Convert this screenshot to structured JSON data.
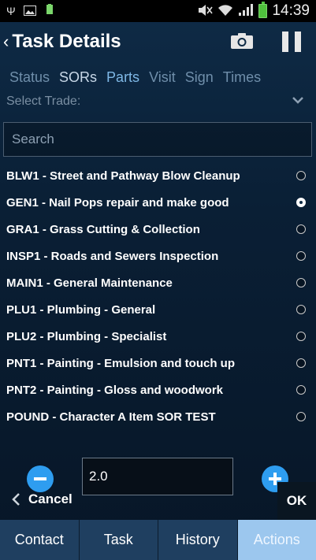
{
  "status_bar": {
    "time": "14:39",
    "icons": [
      "usb-icon",
      "image-icon",
      "battery-100-icon",
      "mute-icon",
      "wifi-icon",
      "signal-icon",
      "battery-icon"
    ],
    "small_battery_label": "100%"
  },
  "header": {
    "title": "Task Details",
    "back_caret": "‹"
  },
  "tabs": [
    {
      "label": "Status"
    },
    {
      "label": "SORs"
    },
    {
      "label": "Parts"
    },
    {
      "label": "Visit"
    },
    {
      "label": "Sign"
    },
    {
      "label": "Times"
    }
  ],
  "select_trade": {
    "label": "Select Trade:"
  },
  "search": {
    "placeholder": "Search",
    "value": ""
  },
  "items": [
    {
      "label": "BLW1 - Street and Pathway Blow Cleanup",
      "selected": false
    },
    {
      "label": "GEN1 - Nail Pops repair and make good",
      "selected": true
    },
    {
      "label": "GRA1 - Grass Cutting & Collection",
      "selected": false
    },
    {
      "label": "INSP1 - Roads and Sewers Inspection",
      "selected": false
    },
    {
      "label": "MAIN1 - General Maintenance",
      "selected": false
    },
    {
      "label": "PLU1 - Plumbing - General",
      "selected": false
    },
    {
      "label": "PLU2 - Plumbing - Specialist",
      "selected": false
    },
    {
      "label": "PNT1 - Painting - Emulsion and touch up",
      "selected": false
    },
    {
      "label": "PNT2 - Painting - Gloss and woodwork",
      "selected": false
    },
    {
      "label": "POUND - Character A Item SOR TEST",
      "selected": false
    }
  ],
  "quantity": {
    "value": "2.0"
  },
  "actions": {
    "cancel_label": "Cancel",
    "ok_label": "OK"
  },
  "bottom_nav": [
    {
      "label": "Contact",
      "active": false
    },
    {
      "label": "Task",
      "active": false
    },
    {
      "label": "History",
      "active": false
    },
    {
      "label": "Actions",
      "active": true
    }
  ],
  "colors": {
    "accent": "#2e9df0",
    "tab_active": "#7fb8e6",
    "tab_inactive": "#6f8eaa",
    "nav_bg": "#1f3f60",
    "nav_active": "#9cc7ee"
  }
}
